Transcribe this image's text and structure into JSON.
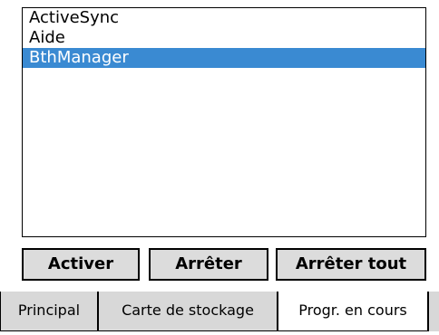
{
  "task_list": {
    "items": [
      {
        "label": "ActiveSync",
        "selected": false
      },
      {
        "label": "Aide",
        "selected": false
      },
      {
        "label": "BthManager",
        "selected": true
      }
    ]
  },
  "buttons": {
    "activate": "Activer",
    "stop": "Arrêter",
    "stop_all": "Arrêter tout"
  },
  "tabs": [
    {
      "label": "Principal",
      "active": false
    },
    {
      "label": "Carte de stockage",
      "active": false
    },
    {
      "label": "Progr. en cours",
      "active": true
    }
  ],
  "colors": {
    "selection": "#3a8ad2",
    "button_face": "#dcdcdc",
    "tab_face": "#d8d8d8"
  }
}
